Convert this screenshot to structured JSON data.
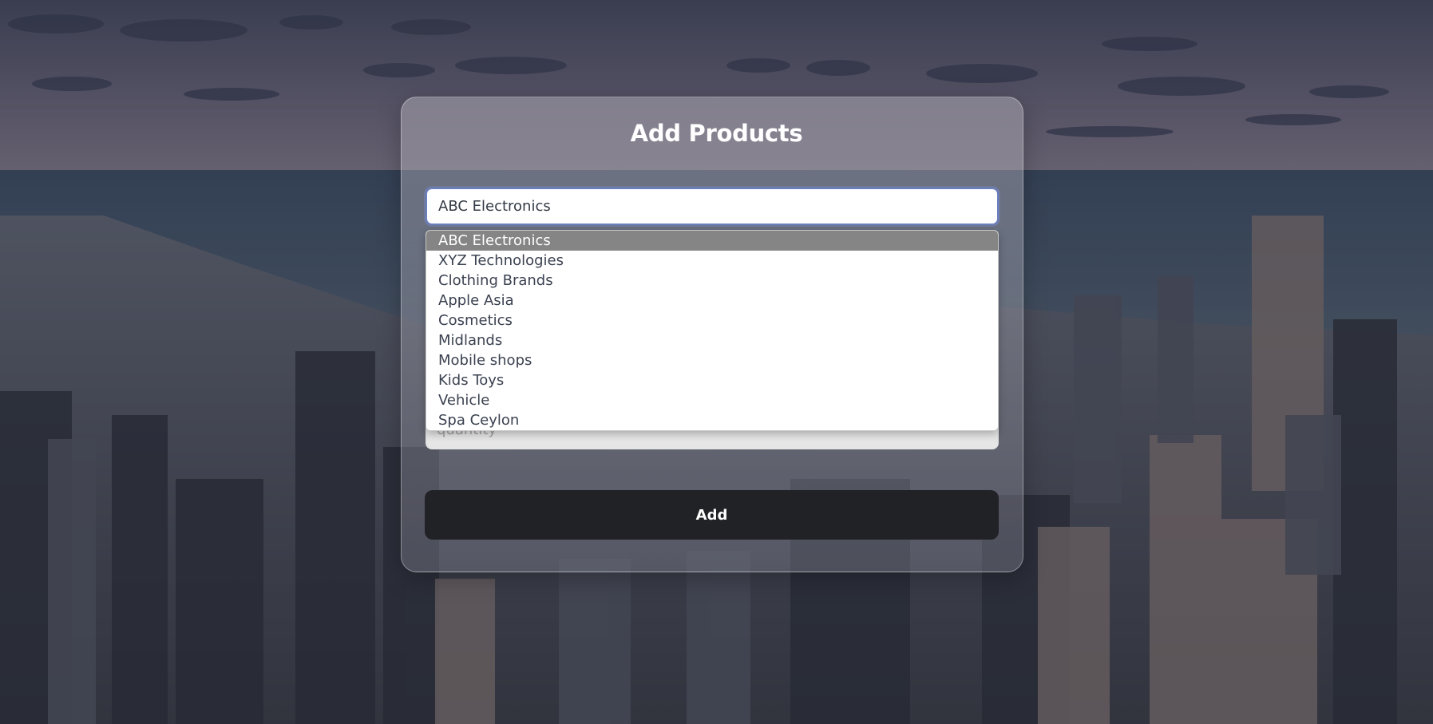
{
  "form": {
    "title": "Add Products",
    "company_select": {
      "selected_value": "ABC Electronics",
      "options": [
        "ABC Electronics",
        "XYZ Technologies",
        "Clothing Brands",
        "Apple Asia",
        "Cosmetics",
        "Midlands",
        "Mobile shops",
        "Kids Toys",
        "Vehicle",
        "Spa Ceylon"
      ],
      "highlighted_index": 0
    },
    "quantity_placeholder": "quantity",
    "add_label": "Add"
  },
  "colors": {
    "button_bg": "#212226",
    "highlight_option_bg": "#858585",
    "focus_border": "#6b7fbf"
  }
}
